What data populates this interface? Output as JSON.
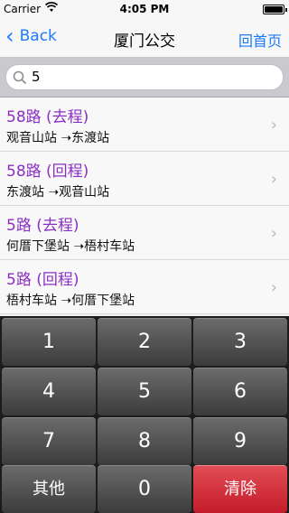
{
  "status_bar": {
    "carrier": "Carrier",
    "time": "4:05 PM"
  },
  "nav": {
    "back_label": "Back",
    "title": "厦门公交",
    "home_label": "回首页"
  },
  "search": {
    "value": "5"
  },
  "routes": [
    {
      "name": "58路 (去程)",
      "route": "观音山站 ➝东渡站"
    },
    {
      "name": "58路 (回程)",
      "route": "东渡站 ➝观音山站"
    },
    {
      "name": "5路 (去程)",
      "route": "何厝下堡站 ➝梧村车站"
    },
    {
      "name": "5路 (回程)",
      "route": "梧村车站 ➝何厝下堡站"
    }
  ],
  "keypad": {
    "keys": [
      "1",
      "2",
      "3",
      "4",
      "5",
      "6",
      "7",
      "8",
      "9",
      "其他",
      "0",
      "清除"
    ]
  },
  "colors": {
    "accent": "#1a7bff",
    "route_name": "#8a2fc2",
    "clear_key": "#d42a35"
  }
}
